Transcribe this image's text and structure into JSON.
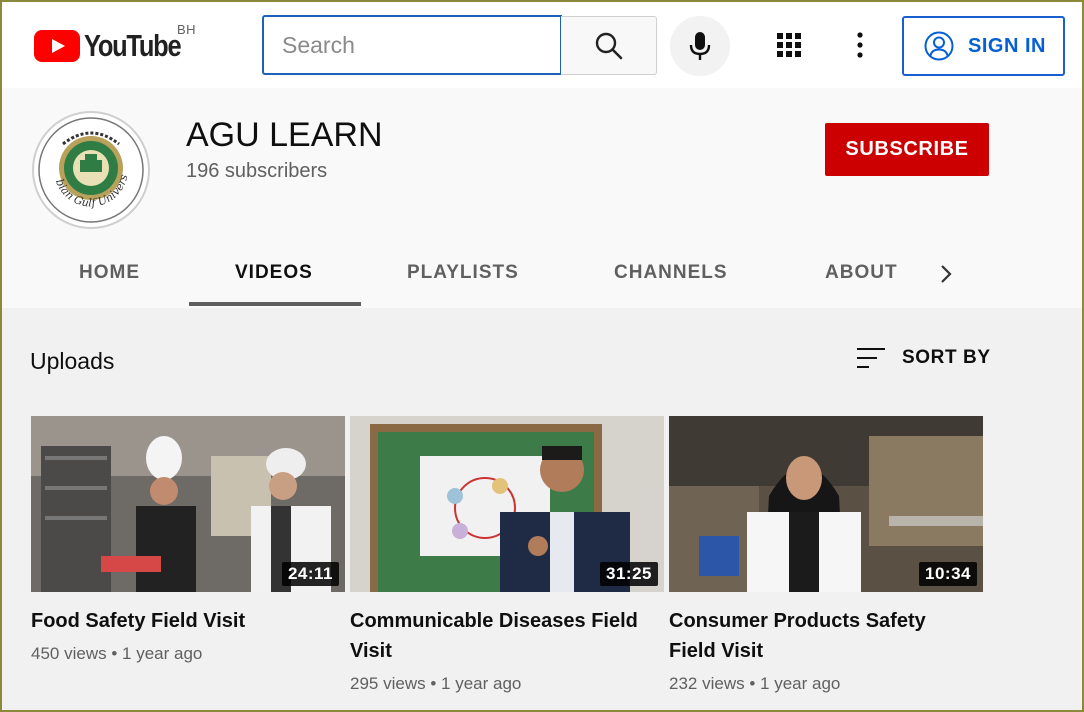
{
  "header": {
    "logo_text": "YouTube",
    "country_code": "BH",
    "search_placeholder": "Search",
    "sign_in_label": "SIGN IN"
  },
  "channel": {
    "name": "AGU LEARN",
    "subscribers": "196 subscribers",
    "subscribe_label": "SUBSCRIBE",
    "avatar_text": "Arabian Gulf University"
  },
  "tabs": [
    {
      "label": "HOME",
      "active": false
    },
    {
      "label": "VIDEOS",
      "active": true
    },
    {
      "label": "PLAYLISTS",
      "active": false
    },
    {
      "label": "CHANNELS",
      "active": false
    },
    {
      "label": "ABOUT",
      "active": false
    }
  ],
  "uploads": {
    "title": "Uploads",
    "sort_label": "SORT BY"
  },
  "videos": [
    {
      "title": "Food Safety Field Visit",
      "duration": "24:11",
      "views": "450 views",
      "age": "1 year ago"
    },
    {
      "title": "Communicable Diseases Field Visit",
      "duration": "31:25",
      "views": "295 views",
      "age": "1 year ago"
    },
    {
      "title": "Consumer Products Safety Field Visit",
      "duration": "10:34",
      "views": "232 views",
      "age": "1 year ago"
    }
  ],
  "colors": {
    "brand_red": "#ff0000",
    "subscribe_red": "#cc0000",
    "link_blue": "#065fd4"
  }
}
